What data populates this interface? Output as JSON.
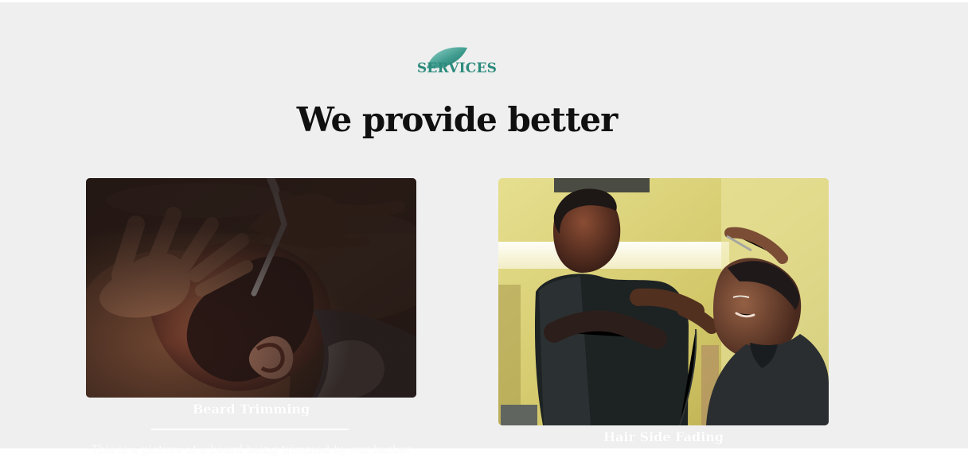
{
  "header": {
    "eyebrow": "SERVICES",
    "title": "We provide better",
    "accent_color": "#2c8b7d"
  },
  "services": [
    {
      "title": "Beard Trimming",
      "description": "This is a picture of a beard being trimmed by our barber",
      "image_alt": "A barber trimming a customer's beard with a straight razor"
    },
    {
      "title": "Hair Side Fading",
      "image_alt": "A smiling barber fading the side of a smiling customer's hair"
    }
  ],
  "colors": {
    "background": "#efefef",
    "text": "#101010",
    "card_text": "#ffffff"
  }
}
